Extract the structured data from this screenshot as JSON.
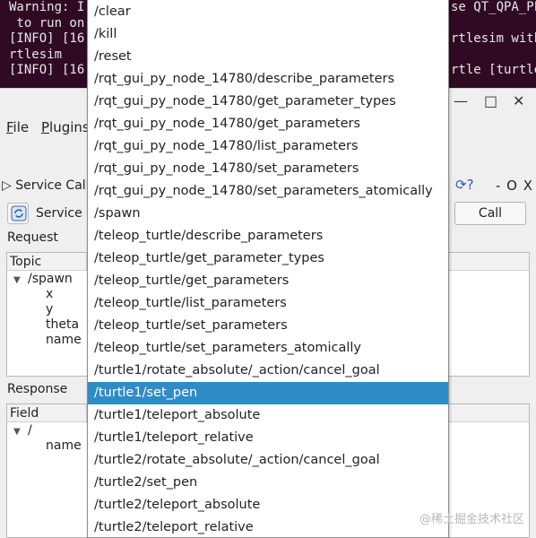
{
  "terminal": {
    "lines": [
      {
        "left": "Warning: I",
        "right": "se QT_QPA_PL"
      },
      {
        "left": " to run on",
        "right": ""
      },
      {
        "left": "[INFO] [16",
        "right": "rtlesim with"
      },
      {
        "left": "rtlesim",
        "right": ""
      },
      {
        "left": "[INFO] [16",
        "right": "rtle [turtle"
      }
    ]
  },
  "rqt": {
    "window_controls": {
      "minimize": "—",
      "maximize": "□",
      "close": "✕"
    },
    "menu": {
      "file": "File",
      "file_key": "F",
      "file_rest": "ile",
      "plugins": "Plugins",
      "plugins_key": "P",
      "plugins_rest": "lugins"
    }
  },
  "plugin": {
    "title": "Service Calle",
    "title_arrow": "▷",
    "controls": "- O X",
    "service_label": "Service",
    "call_label": "Call",
    "request_label": "Request",
    "response_label": "Response",
    "request_tree": {
      "header": "Topic",
      "root": "/spawn",
      "children": [
        "x",
        "y",
        "theta",
        "name"
      ]
    },
    "response_tree": {
      "header": "Field",
      "root": "/",
      "children": [
        "name"
      ]
    }
  },
  "dropdown": {
    "items": [
      "/clear",
      "/kill",
      "/reset",
      "/rqt_gui_py_node_14780/describe_parameters",
      "/rqt_gui_py_node_14780/get_parameter_types",
      "/rqt_gui_py_node_14780/get_parameters",
      "/rqt_gui_py_node_14780/list_parameters",
      "/rqt_gui_py_node_14780/set_parameters",
      "/rqt_gui_py_node_14780/set_parameters_atomically",
      "/spawn",
      "/teleop_turtle/describe_parameters",
      "/teleop_turtle/get_parameter_types",
      "/teleop_turtle/get_parameters",
      "/teleop_turtle/list_parameters",
      "/teleop_turtle/set_parameters",
      "/teleop_turtle/set_parameters_atomically",
      "/turtle1/rotate_absolute/_action/cancel_goal",
      "/turtle1/set_pen",
      "/turtle1/teleport_absolute",
      "/turtle1/teleport_relative",
      "/turtle2/rotate_absolute/_action/cancel_goal",
      "/turtle2/set_pen",
      "/turtle2/teleport_absolute",
      "/turtle2/teleport_relative"
    ],
    "selected_index": 17,
    "selected_color": "#308cc6"
  },
  "watermark": "@稀土掘金技术社区"
}
